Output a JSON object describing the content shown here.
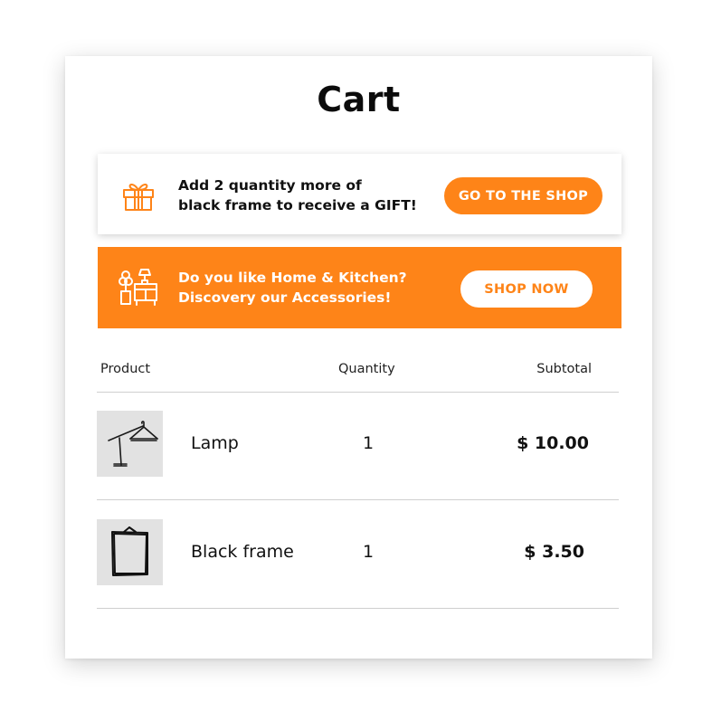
{
  "page": {
    "title": "Cart"
  },
  "gift_banner": {
    "line1": "Add 2 quantity more of",
    "line2": "black frame to receive a GIFT!",
    "button_label": "GO TO THE SHOP",
    "icon": "gift-icon"
  },
  "promo_banner": {
    "line1": "Do you like Home & Kitchen?",
    "line2": "Discovery our Accessories!",
    "button_label": "SHOP NOW",
    "icon": "home-furniture-icon"
  },
  "table": {
    "headers": {
      "product": "Product",
      "quantity": "Quantity",
      "subtotal": "Subtotal"
    },
    "rows": [
      {
        "name": "Lamp",
        "quantity": "1",
        "subtotal": "$ 10.00",
        "thumbnail": "lamp-image"
      },
      {
        "name": "Black frame",
        "quantity": "1",
        "subtotal": "$ 3.50",
        "thumbnail": "frame-image"
      }
    ]
  },
  "colors": {
    "accent": "#fe8418",
    "text": "#111111",
    "thumbnail_bg": "#e2e2e2",
    "divider": "#cfcfcf"
  }
}
